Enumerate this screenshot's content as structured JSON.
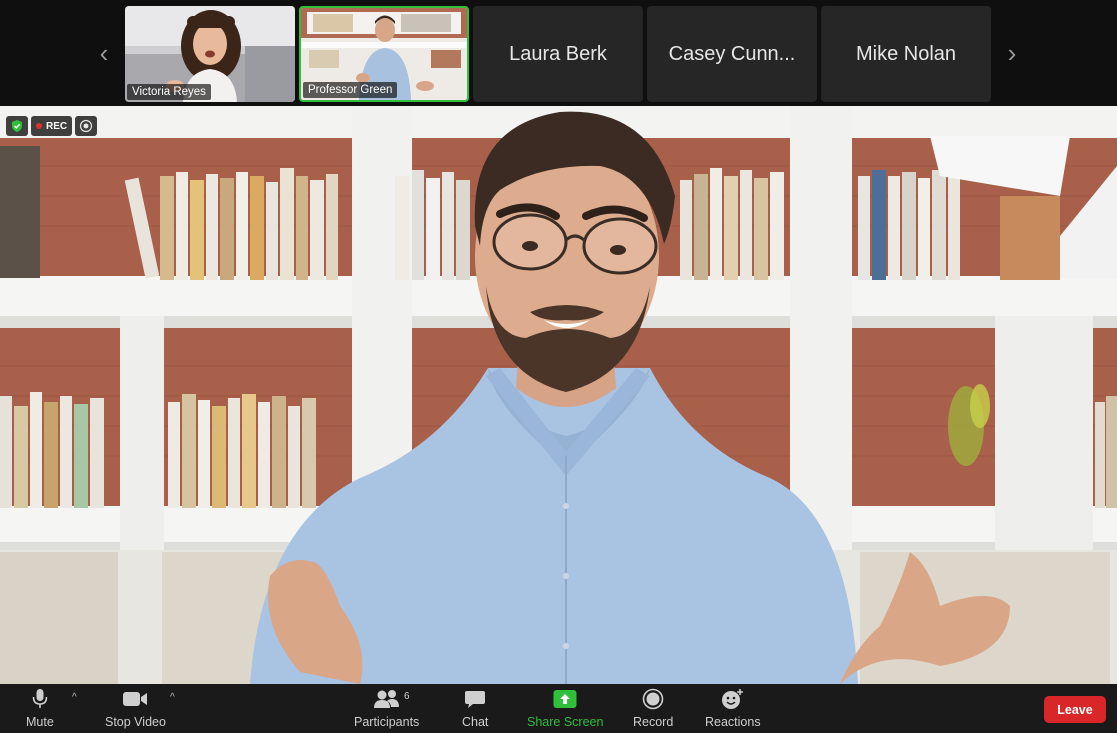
{
  "gallery": {
    "participants": [
      {
        "name": "Victoria Reyes",
        "has_video": true
      },
      {
        "name": "Professor Green",
        "has_video": true,
        "active_speaker": true
      },
      {
        "name": "Laura Berk",
        "has_video": false
      },
      {
        "name": "Casey Cunn...",
        "has_video": false
      },
      {
        "name": "Mike Nolan",
        "has_video": false
      }
    ],
    "prev_icon": "chevron-left-icon",
    "next_icon": "chevron-right-icon",
    "active_border_color": "#2fbf3a"
  },
  "main_video": {
    "speaker": "Professor Green",
    "status": {
      "encryption_icon": "shield-check-icon",
      "rec_label": "REC",
      "rec_color": "#e0302c",
      "live_icon": "broadcast-icon"
    }
  },
  "toolbar": {
    "mute_label": "Mute",
    "stop_video_label": "Stop Video",
    "participants_label": "Participants",
    "participants_count": "6",
    "chat_label": "Chat",
    "share_label": "Share Screen",
    "share_color": "#2fbf3a",
    "record_label": "Record",
    "reactions_label": "Reactions",
    "leave_label": "Leave",
    "leave_color": "#d92629"
  }
}
